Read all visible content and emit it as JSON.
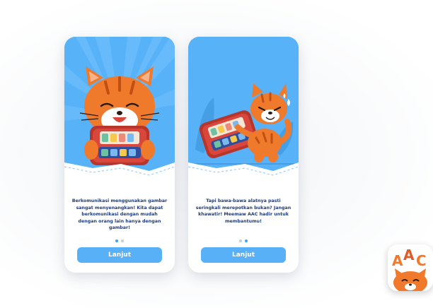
{
  "screens": [
    {
      "message": "Berkomunikasi menggunakan gambar sangat menyenangkan! Kita dapat berkomunikasi dengan mudah dengan orang lain hanya dengan gambar!",
      "button_label": "Lanjut",
      "active_dot": 1
    },
    {
      "message": "Tapi bawa-bawa alatnya pasti seringkali merepotkan bukan? Jangan khawatir! Meemaw AAC hadir untuk membantumu!",
      "button_label": "Lanjut",
      "active_dot": 2
    }
  ],
  "app_icon": {
    "text": "AAC"
  },
  "colors": {
    "hero_blue": "#57b2f8",
    "button_blue": "#58b1f6",
    "text_navy": "#1e3c7a",
    "cat_orange": "#f07a2c"
  }
}
